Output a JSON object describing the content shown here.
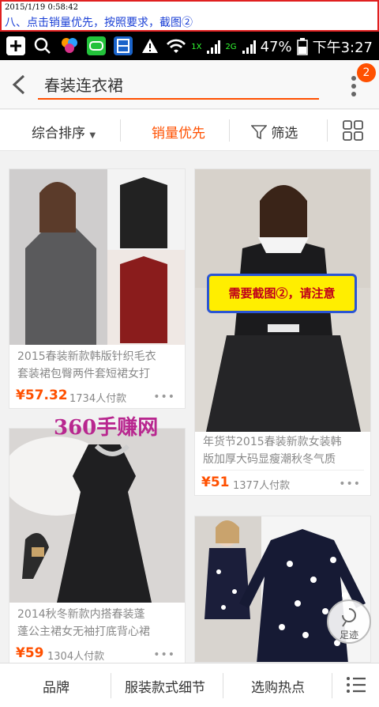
{
  "banner": {
    "timestamp": "2015/1/19 0:58:42",
    "instruction": "八、点击销量优先，按照要求，截图②"
  },
  "status": {
    "battery": "47%",
    "time": "下午3:27",
    "net1": "1X",
    "net2": "2G"
  },
  "search": {
    "query": "春装连衣裙"
  },
  "badge_count": "2",
  "sort": {
    "tabs": [
      "综合排序",
      "销量优先",
      "筛选"
    ]
  },
  "note": "需要截图②，请注意",
  "watermark": "360手赚网",
  "products": [
    {
      "title_l1": "2015春装新款韩版针织毛衣",
      "title_l2": "套装裙包臀两件套短裙女打",
      "price": "¥57.32",
      "sold": "1734人付款"
    },
    {
      "title_l1": "年货节2015春装新款女装韩",
      "title_l2": "版加厚大码显瘦潮秋冬气质",
      "price": "¥51",
      "sold": "1377人付款"
    },
    {
      "title_l1": "2014秋冬新款内搭春装蓬",
      "title_l2": "蓬公主裙女无袖打底背心裙",
      "price": "¥59",
      "sold": "1304人付款"
    },
    {
      "title_l1": "",
      "title_l2": "",
      "price": "",
      "sold": ""
    }
  ],
  "footprint_label": "足迹",
  "bottom": {
    "items": [
      "品牌",
      "服装款式细节",
      "选购热点"
    ]
  },
  "colors": {
    "accent": "#ff5000",
    "banner_border": "#e02020",
    "note_bg": "#ffee00"
  }
}
